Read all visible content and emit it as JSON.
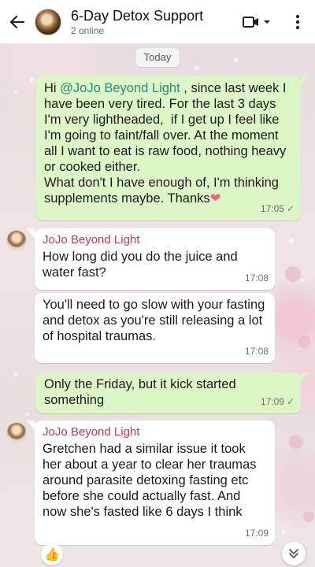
{
  "header": {
    "title": "6-Day Detox Support",
    "subtitle": "2 online",
    "back_icon": "arrow-left-icon",
    "video_icon": "video-camera-icon",
    "menu_icon": "more-vertical-icon"
  },
  "date_chip": "Today",
  "messages": [
    {
      "direction": "out",
      "greeting": "Hi ",
      "mention": "@JoJo Beyond Light",
      "text": " , since last week I have been very tired. For the last 3 days I'm very lightheaded,  if I get up I feel like I'm going to faint/fall over. At the moment all I want to eat is raw food, nothing heavy or cooked either.\nWhat don't I have enough of, I'm thinking supplements maybe. Thanks",
      "emoji": "❤",
      "time": "17:05",
      "status": "✓"
    },
    {
      "direction": "in",
      "sender": "JoJo Beyond Light",
      "text": "How long did you do the juice and water fast?",
      "time": "17:08"
    },
    {
      "direction": "in",
      "text": "You'll need to go slow with your fasting and detox as you're still releasing a lot of hospital traumas.",
      "time": "17:08"
    },
    {
      "direction": "out",
      "text": "Only the Friday, but it kick started something",
      "time": "17:09",
      "status": "✓"
    },
    {
      "direction": "in",
      "sender": "JoJo Beyond Light",
      "text": "Gretchen had a similar issue it took her about a year to clear her traumas around parasite detoxing fasting etc before she could actually fast. And now she's fasted like 6 days I think",
      "time": "17:09"
    }
  ],
  "reaction_emoji": "👍",
  "colors": {
    "outgoing_bubble": "#dcf6c6",
    "incoming_bubble": "#ffffff",
    "sender_name": "#c0394b",
    "mention": "#2b8a74"
  }
}
